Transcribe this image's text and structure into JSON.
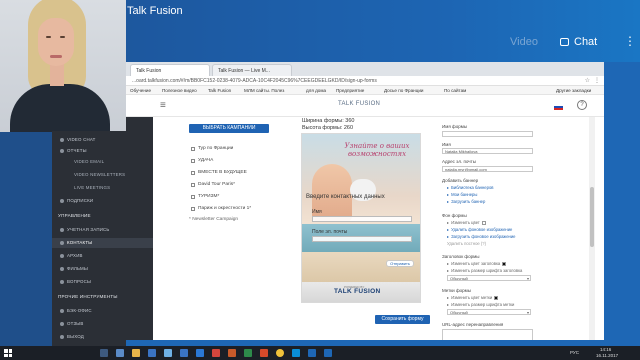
{
  "app": {
    "title": "Talk Fusion",
    "chat_label": "Chat",
    "ghost_label": "Video"
  },
  "browser": {
    "tabs": [
      "Talk Fusion",
      "Talk Fusion — Live M..."
    ],
    "url": "...oard.talkfusion.com/#/m/BB0FC152-0238-4079-ADCA-10C4F2045C96%7CEEGDEELGKD/ID/sign-up-forms",
    "bookmarks": [
      "Обучение",
      "Полезное видео",
      "Talk Fusion",
      "MЛМ сайты. Полез",
      "для дома",
      "Предприятие",
      "Досье по Франции",
      "По сайтам",
      "Другие закладки"
    ]
  },
  "site": {
    "logo": "TALK FUSION"
  },
  "nav": {
    "items": [
      {
        "label": "VIDEO CHAT",
        "kind": "item"
      },
      {
        "label": "ОТЧЕТЫ",
        "kind": "item"
      },
      {
        "label": "VIDEO EMAIL",
        "kind": "sub"
      },
      {
        "label": "VIDEO NEWSLETTERS",
        "kind": "sub"
      },
      {
        "label": "LIVE MEETINGS",
        "kind": "sub"
      },
      {
        "label": "ПОДПИСКИ",
        "kind": "item"
      },
      {
        "label": "УПРАВЛЕНИЕ",
        "kind": "group"
      },
      {
        "label": "УЧЕТНАЯ ЗАПИСЬ",
        "kind": "item"
      },
      {
        "label": "КОНТАКТЫ",
        "kind": "item"
      },
      {
        "label": "АРХИВ",
        "kind": "item"
      },
      {
        "label": "ФИЛЬМЫ",
        "kind": "item"
      },
      {
        "label": "ВОПРОСЫ",
        "kind": "item"
      },
      {
        "label": "ПРОЧИЕ ИНСТРУМЕНТЫ",
        "kind": "group"
      },
      {
        "label": "БЭК-ОФИС",
        "kind": "item"
      },
      {
        "label": "ОТЗЫВ",
        "kind": "item"
      },
      {
        "label": "ВЫХОД",
        "kind": "item"
      }
    ]
  },
  "main": {
    "choose_campaign": "ВЫБРАТЬ КАМПАНИИ",
    "campaigns": [
      "Тур по Франции",
      "УДАЧА",
      "ВМЕСТЕ В БУДУЩЕЕ",
      "David Tour Paris*",
      "ТУРИЗМ*",
      "Париж и окрестности 1*",
      "* Newsletter Campaign"
    ],
    "form_width": "Ширина формы: 360",
    "form_height": "Высота формы: 260",
    "save_form": "Сохранить форму"
  },
  "preview": {
    "title": "Узнайте о ваших возможностях",
    "section": "Введите контактных данных",
    "name_label": "Имя",
    "email_label": "Поле эл. почты",
    "submit": "Отправить",
    "brand": "TALK FUSION",
    "powered": "POWERED BY"
  },
  "rightform": {
    "form_name_label": "Имя формы",
    "name_label": "Имя",
    "name_value": "Natalia Mikhailova",
    "email_label": "Адрес эл. почты",
    "email_value": "natalia.myr@gmail.com",
    "banner_label": "Добавить баннер",
    "banner_links": [
      "Библиотека баннеров",
      "Мои баннеры",
      "Загрузить баннер"
    ],
    "bg_label": "Фон формы",
    "bg_color": "Изменить цвет",
    "bg_links": [
      "Удалить фоновое изображение",
      "Загрузить фоновое изображение"
    ],
    "bg_delete": "Удалить постное (?)",
    "title_label": "Заголовок формы",
    "title_color": "Изменить цвет заголовка",
    "title_size": "Изменить размер шрифта заголовка",
    "title_select": "Обычный",
    "labels_label": "Метки формы",
    "labels_color": "Изменить цвет метки",
    "labels_size": "Изменить размер шрифта метки",
    "labels_select": "Обычный",
    "redirect_label": "URL-адрес перенаправления"
  },
  "taskbar": {
    "lang": "РУС",
    "time": "14:16",
    "date": "16.11.2017"
  },
  "colors": {
    "brand_blue": "#1f63b3",
    "nav_bg": "#2b2f36",
    "topbar": "#1d5296"
  }
}
